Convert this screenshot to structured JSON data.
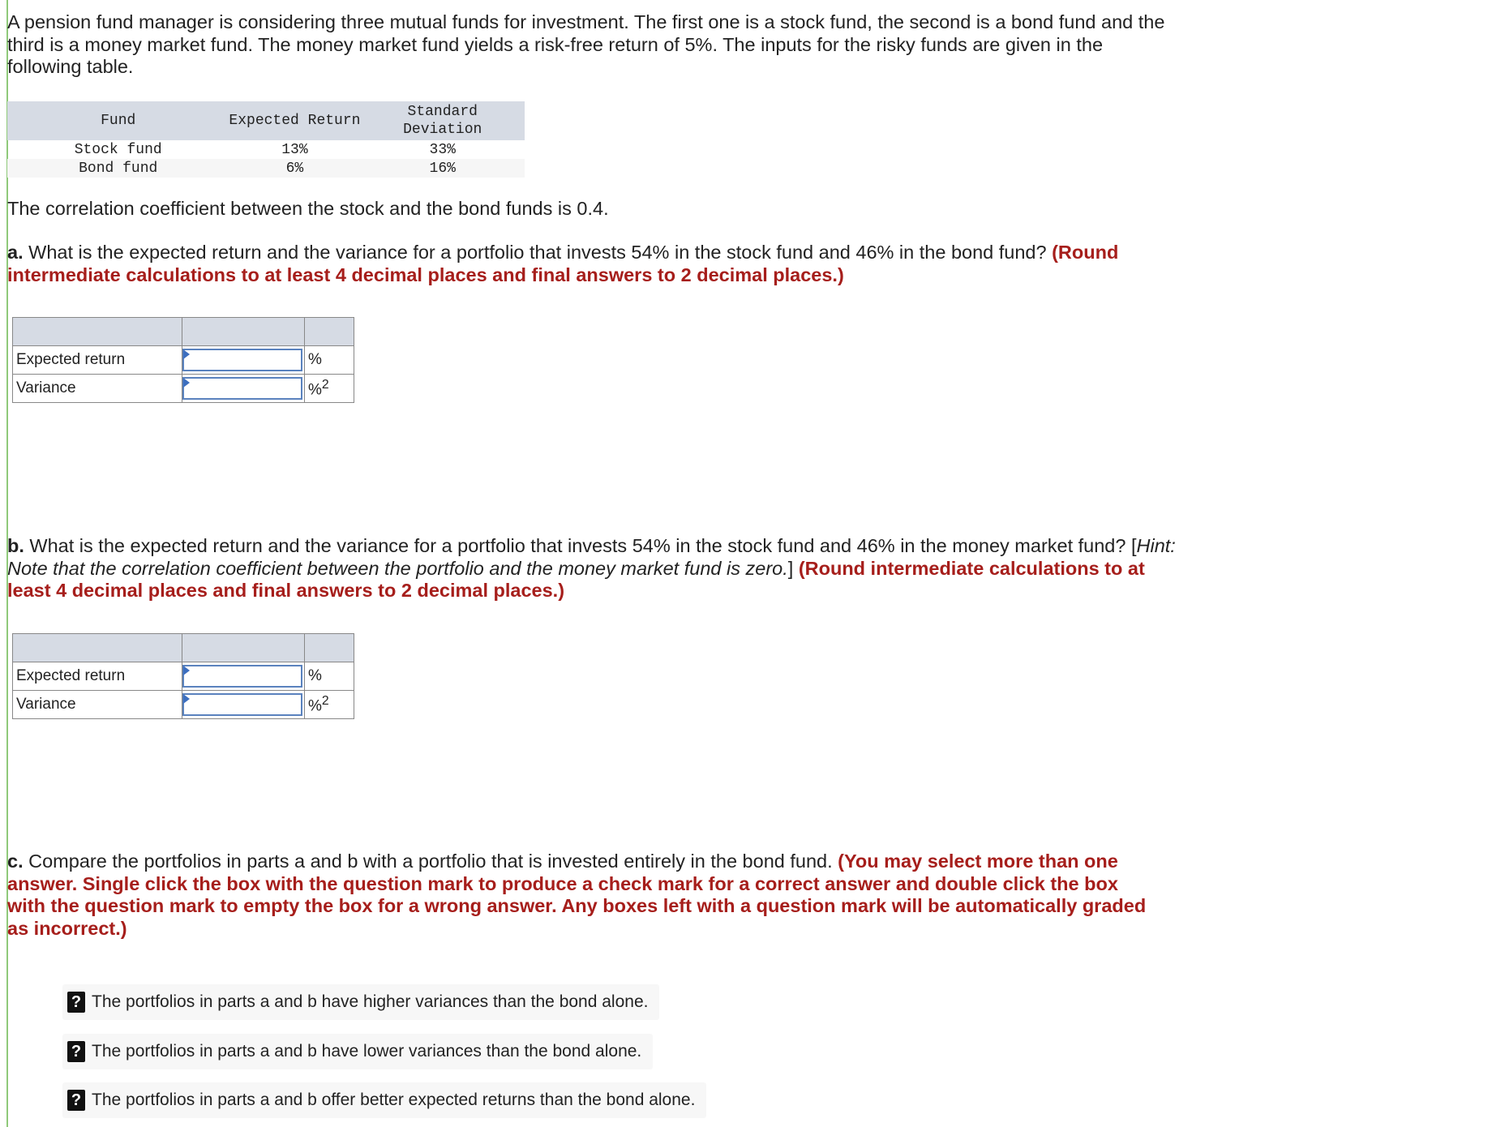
{
  "intro": "A pension fund manager is considering three mutual funds for investment. The first one is a stock fund, the second is a bond fund and the third is a money market fund. The money market fund yields a risk-free return of 5%. The inputs for the risky funds are given in the following table.",
  "fund_table": {
    "headers": [
      "Fund",
      "Expected Return",
      "Standard",
      "Deviation"
    ],
    "rows": [
      [
        "Stock fund",
        "13%",
        "33%"
      ],
      [
        "Bond fund",
        "6%",
        "16%"
      ]
    ]
  },
  "correlation_text": "The correlation coefficient between the stock and the bond funds is 0.4.",
  "part_a": {
    "label": "a.",
    "question": " What is the expected return and the variance for a portfolio that invests 54% in the stock fund and 46% in the bond fund? ",
    "instruction": "(Round intermediate calculations to at least 4 decimal places and final answers to 2 decimal places.)",
    "rows": [
      {
        "label": "Expected return",
        "value": "",
        "unit": "%"
      },
      {
        "label": "Variance",
        "value": "",
        "unit": "%",
        "sup": "2"
      }
    ]
  },
  "part_b": {
    "label": "b.",
    "question": " What is the expected return and the variance for a portfolio that invests 54% in the stock fund and 46% in the money market fund? ",
    "hint_open": "[",
    "hint": "Hint: Note that the correlation coefficient between the portfolio and the money market fund is zero.",
    "hint_close": "] ",
    "instruction": "(Round intermediate calculations to at least 4 decimal places and final answers to 2 decimal places.)",
    "rows": [
      {
        "label": "Expected return",
        "value": "",
        "unit": "%"
      },
      {
        "label": "Variance",
        "value": "",
        "unit": "%",
        "sup": "2"
      }
    ]
  },
  "part_c": {
    "label": "c.",
    "question": " Compare the portfolios in parts a and b with a portfolio that is invested entirely in the bond fund. ",
    "instruction": "(You may select more than one answer. Single click the box with the question mark to produce a check mark for a correct answer and double click the box with the question mark to empty the box for a wrong answer. Any boxes left with a question mark will be automatically graded as incorrect.)",
    "choice_icon": "?",
    "choices": [
      "The portfolios in parts a and b have higher variances than the bond alone.",
      "The portfolios in parts a and b have lower variances than the bond alone.",
      "The portfolios in parts a and b offer better expected returns than the bond alone."
    ]
  }
}
